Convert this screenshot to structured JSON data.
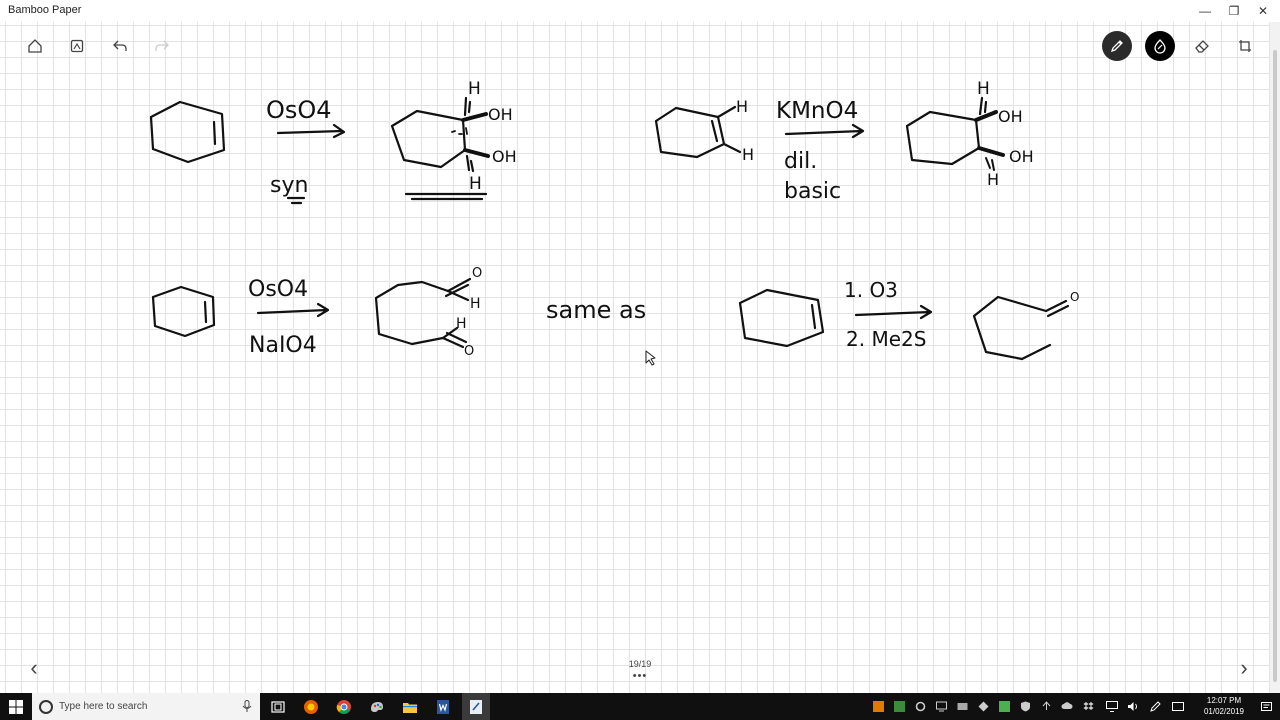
{
  "window": {
    "title": "Bamboo Paper",
    "minimize_glyph": "—",
    "maximize_glyph": "❐",
    "close_glyph": "✕"
  },
  "toolbar_icons": [
    "home-icon",
    "notebook-icon",
    "undo-icon",
    "redo-icon"
  ],
  "tools": [
    "pen-icon",
    "ink-color-icon",
    "eraser-icon",
    "crop-icon"
  ],
  "notes": {
    "reaction1": {
      "reagent": "OsO4",
      "condition": "syn",
      "label_h_top": "H",
      "label_h_bottom": "H",
      "label_oh_1": "OH",
      "label_oh_2": "OH"
    },
    "reaction2": {
      "reagent": "KMnO4",
      "condition_1": "dil.",
      "condition_2": "basic",
      "label_h_1": "H",
      "label_h_2": "H",
      "label_h_top": "H",
      "label_h_bottom": "H",
      "label_oh_1": "OH",
      "label_oh_2": "OH"
    },
    "reaction3": {
      "reagent_1": "OsO4",
      "reagent_2": "NaIO4",
      "label_o_top": "O",
      "label_h_top": "H",
      "label_h_bottom": "H",
      "label_o_bottom": "O"
    },
    "comparison": "same as",
    "reaction4": {
      "step_1": "1. O3",
      "step_2": "2. Me2S",
      "label_o": "O"
    }
  },
  "pager": {
    "indicator": "19/19",
    "dots": "•••",
    "prev_glyph": "‹",
    "next_glyph": "›"
  },
  "taskbar": {
    "search_placeholder": "Type here to search",
    "time": "12:07 PM",
    "date": "01/02/2019"
  }
}
